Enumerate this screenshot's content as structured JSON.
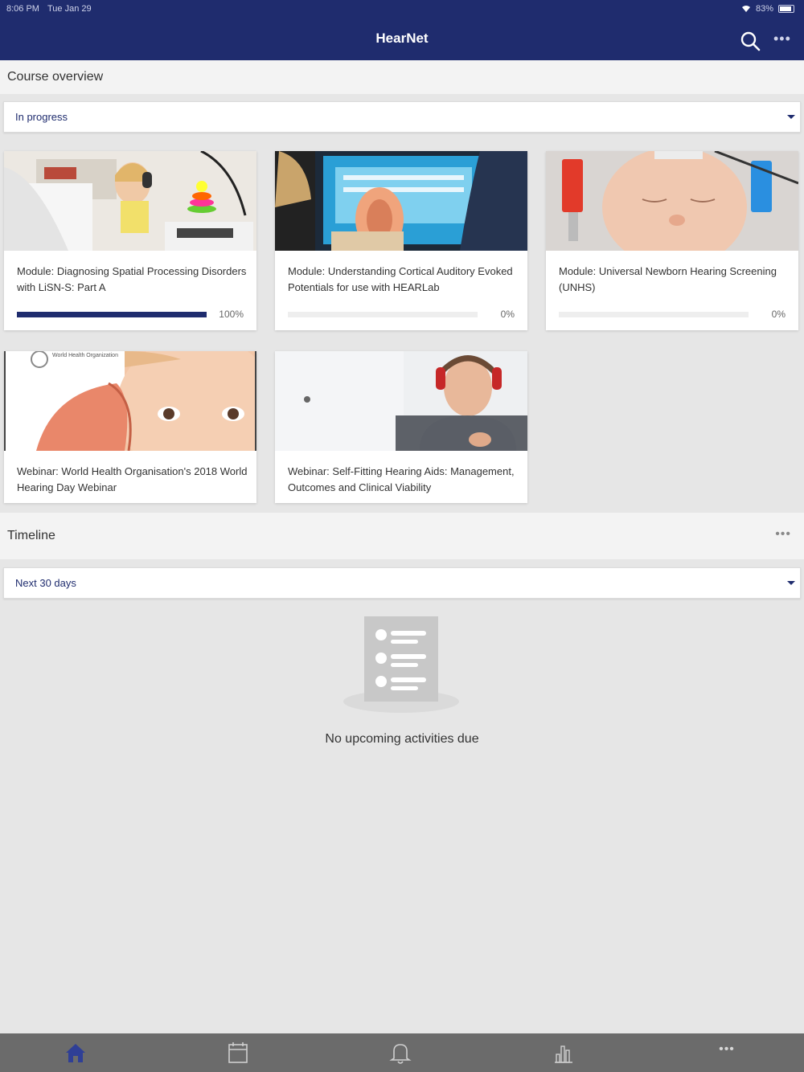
{
  "status_bar": {
    "time": "8:06 PM",
    "date": "Tue Jan 29",
    "battery": "83%"
  },
  "app": {
    "title": "HearNet"
  },
  "course_overview": {
    "heading": "Course overview",
    "filter_value": "In progress",
    "courses": [
      {
        "title": "Module: Diagnosing Spatial Processing Disorders with LiSN-S: Part A",
        "progress_label": "100%",
        "progress": 100
      },
      {
        "title": "Module: Understanding Cortical Auditory Evoked Potentials for use with HEARLab",
        "progress_label": "0%",
        "progress": 0
      },
      {
        "title": "Module: Universal Newborn Hearing Screening (UNHS)",
        "progress_label": "0%",
        "progress": 0
      },
      {
        "title": "Webinar: World Health Organisation's 2018 World Hearing Day Webinar",
        "thumb_text": "World Health Organization"
      },
      {
        "title": "Webinar: Self-Fitting Hearing Aids: Management, Outcomes and Clinical Viability"
      }
    ]
  },
  "timeline": {
    "heading": "Timeline",
    "filter_value": "Next 30 days",
    "empty_message": "No upcoming activities due"
  },
  "colors": {
    "brand": "#1f2c6e",
    "bottom_nav": "#6b6b6b",
    "background": "#e6e6e6"
  },
  "bottom_nav": [
    "home-icon",
    "calendar-icon",
    "bell-icon",
    "grades-icon",
    "more-icon"
  ]
}
